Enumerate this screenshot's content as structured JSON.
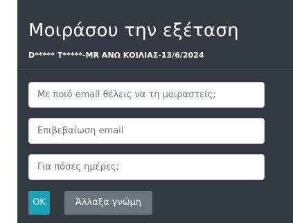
{
  "modal": {
    "title": "Μοιράσου την εξέταση",
    "subtitle": "D***** T*****-MR ΑΝΩ ΚΟΙΛΙΑΣ-13/6/2024"
  },
  "form": {
    "email": {
      "value": "",
      "placeholder": "Με ποιό email θέλεις να τη μοιραστείς;"
    },
    "confirm_email": {
      "value": "",
      "placeholder": "Επιβεβαίωση email"
    },
    "days": {
      "value": "",
      "placeholder": "Για πόσες ημέρες;"
    }
  },
  "buttons": {
    "ok_label": "OK",
    "cancel_label": "Άλλαξα γνώμη"
  },
  "colors": {
    "modal_background": "#343a40",
    "ok_button": "#17a2b8",
    "cancel_button": "#6c757d"
  }
}
